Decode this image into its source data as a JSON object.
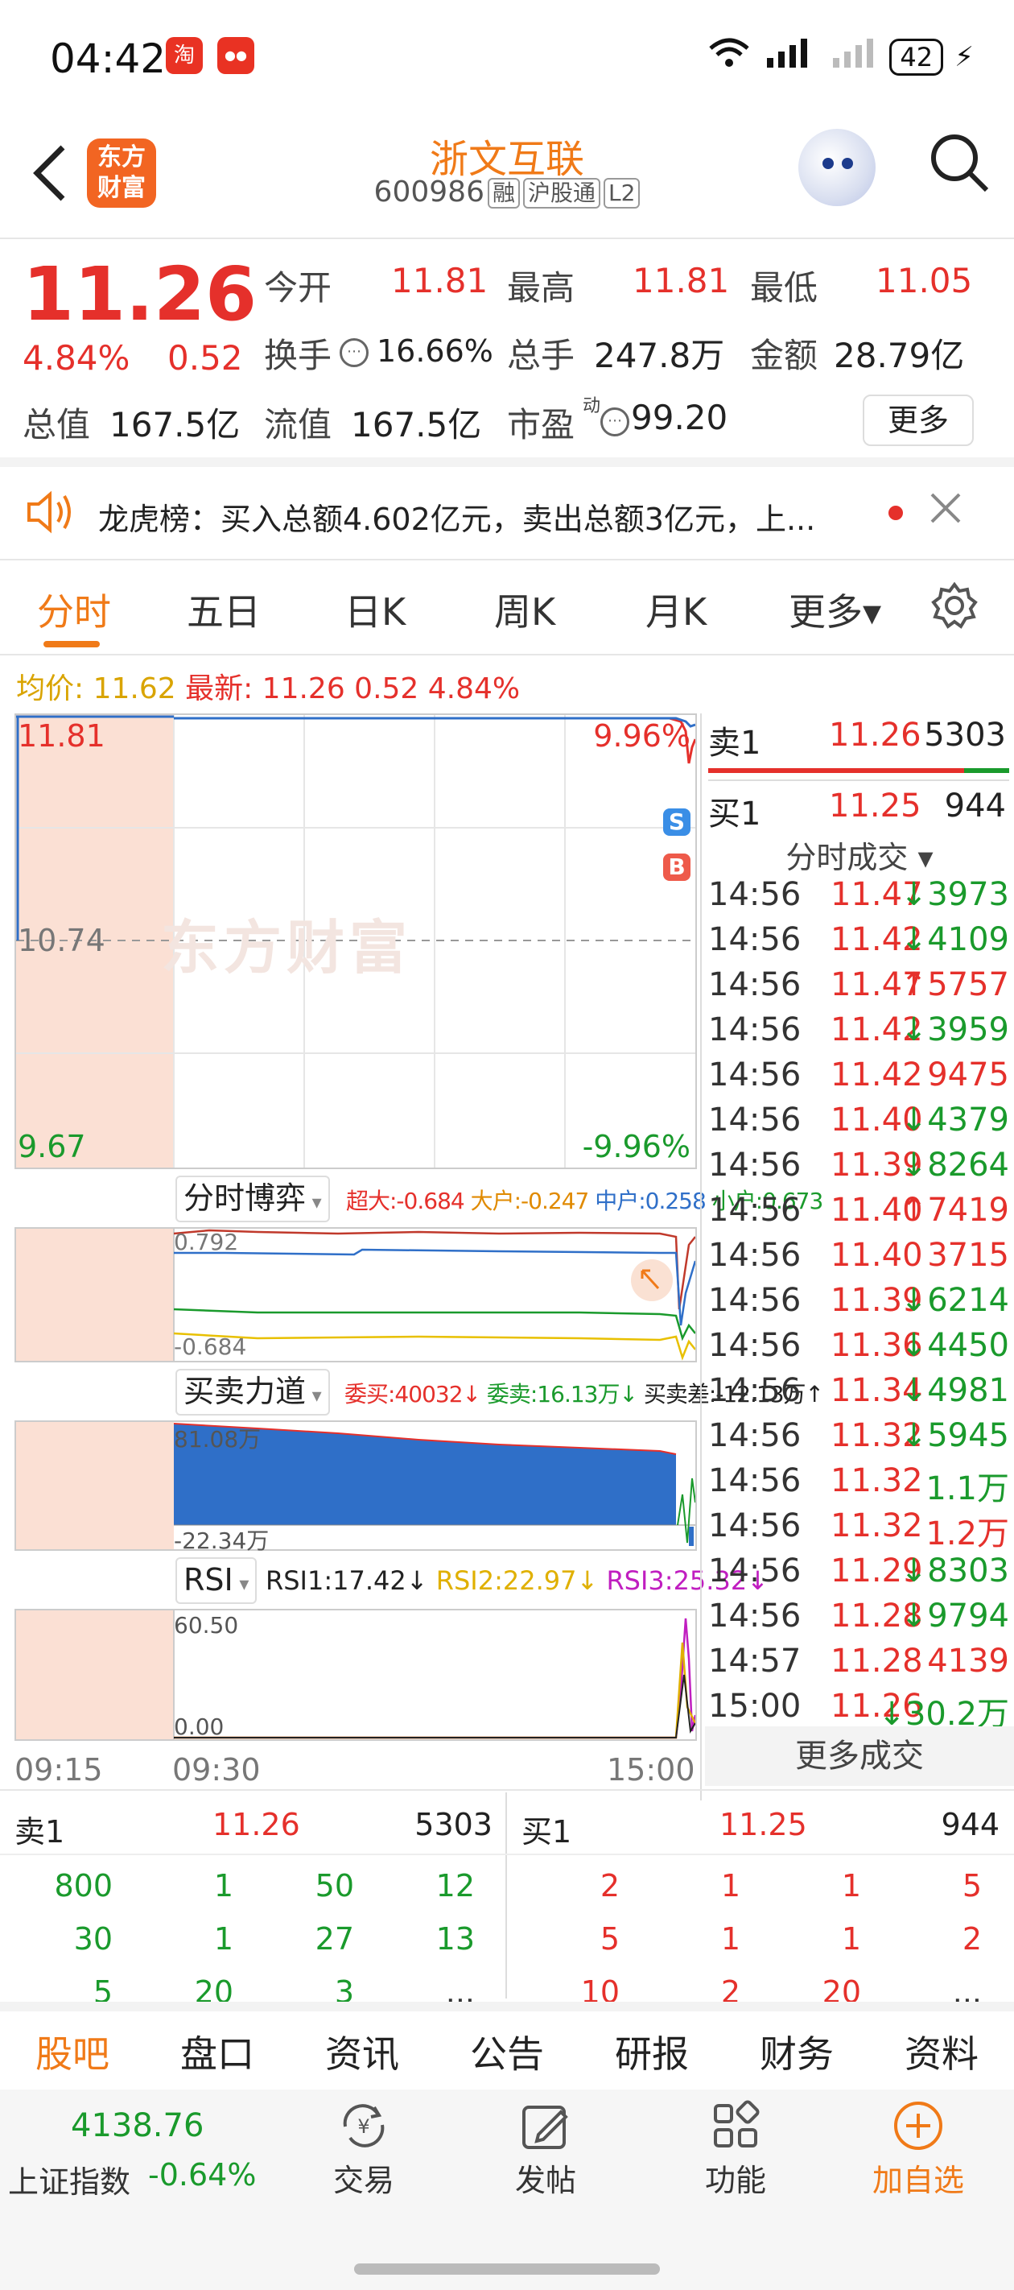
{
  "status_bar": {
    "time": "04:42",
    "app1": "淘",
    "app2": "淘",
    "battery": "42",
    "network": "6 5A"
  },
  "header": {
    "logo": "东方\n财富",
    "name": "浙文互联",
    "code": "600986",
    "tags": [
      "融",
      "沪股通",
      "L2"
    ]
  },
  "quote": {
    "price": "11.26",
    "chg_pct": "4.84%",
    "chg_amt": "0.52",
    "open_label": "今开",
    "open": "11.81",
    "high_label": "最高",
    "high": "11.81",
    "low_label": "最低",
    "low": "11.05",
    "turnover_label": "换手",
    "turnover": "16.66%",
    "volume_label": "总手",
    "volume": "247.8万",
    "amount_label": "金额",
    "amount": "28.79亿",
    "mcap_label": "总值",
    "mcap": "167.5亿",
    "float_label": "流值",
    "float": "167.5亿",
    "pe_label": "市盈",
    "pe_sup": "动",
    "pe": "99.20",
    "more": "更多"
  },
  "notice": {
    "text": "龙虎榜：买入总额4.602亿元，卖出总额3亿元，上..."
  },
  "tabs": [
    {
      "label": "分时"
    },
    {
      "label": "五日"
    },
    {
      "label": "日K"
    },
    {
      "label": "周K"
    },
    {
      "label": "月K"
    },
    {
      "label": "更多▾"
    }
  ],
  "infoline": {
    "avg": "均价: 11.62",
    "latest": "最新: 11.26 0.52 4.84%"
  },
  "chart": {
    "max": "11.81",
    "max_pct": "9.96%",
    "mid": "10.74",
    "min": "9.67",
    "min_pct": "-9.96%",
    "bg": "东方财富",
    "sbadge": "S",
    "bbadge": "B",
    "t1": "09:15",
    "t2": "09:30",
    "t3": "15:00"
  },
  "game": {
    "select": "分时博弈",
    "chao": "超大:-0.684",
    "da": "大户:-0.247",
    "zhong": "中户:0.258",
    "xiao": "小户:0.673",
    "top": "0.792",
    "bottom": "-0.684"
  },
  "force": {
    "select": "买卖力道",
    "weimai": "委买:40032↓",
    "weimai2": "委卖:16.13万↓",
    "cha": "买卖差:-12.13万↑",
    "top": "81.08万",
    "bottom": "-22.34万"
  },
  "rsi": {
    "select": "RSI",
    "r1": "RSI1:17.42↓",
    "r2": "RSI2:22.97↓",
    "r3": "RSI3:25.32↓",
    "top": "60.50",
    "bottom": "0.00"
  },
  "side": {
    "sell1_label": "卖1",
    "sell1_price": "11.26",
    "sell1_vol": "5303",
    "buy1_label": "买1",
    "buy1_price": "11.25",
    "buy1_vol": "944",
    "ticks_title": "分时成交 ▾",
    "ticks": [
      {
        "t": "14:56",
        "p": "11.47",
        "v": "↓3973",
        "c": "green"
      },
      {
        "t": "14:56",
        "p": "11.42",
        "v": "↓4109",
        "c": "green"
      },
      {
        "t": "14:56",
        "p": "11.47",
        "v": "↑5757",
        "c": "red"
      },
      {
        "t": "14:56",
        "p": "11.42",
        "v": "↓3959",
        "c": "green"
      },
      {
        "t": "14:56",
        "p": "11.42",
        "v": " 9475",
        "c": "red"
      },
      {
        "t": "14:56",
        "p": "11.40",
        "v": "↓4379",
        "c": "green"
      },
      {
        "t": "14:56",
        "p": "11.39",
        "v": "↓8264",
        "c": "green"
      },
      {
        "t": "14:56",
        "p": "11.40",
        "v": "↑7419",
        "c": "red"
      },
      {
        "t": "14:56",
        "p": "11.40",
        "v": " 3715",
        "c": "red"
      },
      {
        "t": "14:56",
        "p": "11.39",
        "v": "↓6214",
        "c": "green"
      },
      {
        "t": "14:56",
        "p": "11.36",
        "v": "↓4450",
        "c": "green"
      },
      {
        "t": "14:56",
        "p": "11.34",
        "v": "↓4981",
        "c": "green"
      },
      {
        "t": "14:56",
        "p": "11.32",
        "v": "↓5945",
        "c": "green"
      },
      {
        "t": "14:56",
        "p": "11.32",
        "v": " 1.1万",
        "c": "green"
      },
      {
        "t": "14:56",
        "p": "11.32",
        "v": " 1.2万",
        "c": "red"
      },
      {
        "t": "14:56",
        "p": "11.29",
        "v": "↓8303",
        "c": "green"
      },
      {
        "t": "14:56",
        "p": "11.28",
        "v": "↓9794",
        "c": "green"
      },
      {
        "t": "14:57",
        "p": "11.28",
        "v": " 4139",
        "c": "red"
      },
      {
        "t": "15:00",
        "p": "11.26",
        "v": "↓30.2万",
        "c": "green"
      }
    ],
    "more_ticks": "更多成交"
  },
  "orderbook": {
    "sell_label": "卖1",
    "sell_price": "11.26",
    "sell_vol": "5303",
    "buy_label": "买1",
    "buy_price": "11.25",
    "buy_vol": "944",
    "sell_rows": [
      [
        "800",
        "1",
        "50",
        "12"
      ],
      [
        "30",
        "1",
        "27",
        "13"
      ],
      [
        "5",
        "20",
        "3",
        "..."
      ]
    ],
    "buy_rows": [
      [
        "2",
        "1",
        "1",
        "5"
      ],
      [
        "5",
        "1",
        "1",
        "2"
      ],
      [
        "10",
        "2",
        "20",
        "..."
      ]
    ]
  },
  "subtabs": [
    "股吧",
    "盘口",
    "资讯",
    "公告",
    "研报",
    "财务",
    "资料"
  ],
  "bottom": {
    "index_value": "4138.76",
    "index_name": "上证指数",
    "index_chg": "-0.64%",
    "trade": "交易",
    "post": "发帖",
    "func": "功能",
    "add": "加自选"
  }
}
